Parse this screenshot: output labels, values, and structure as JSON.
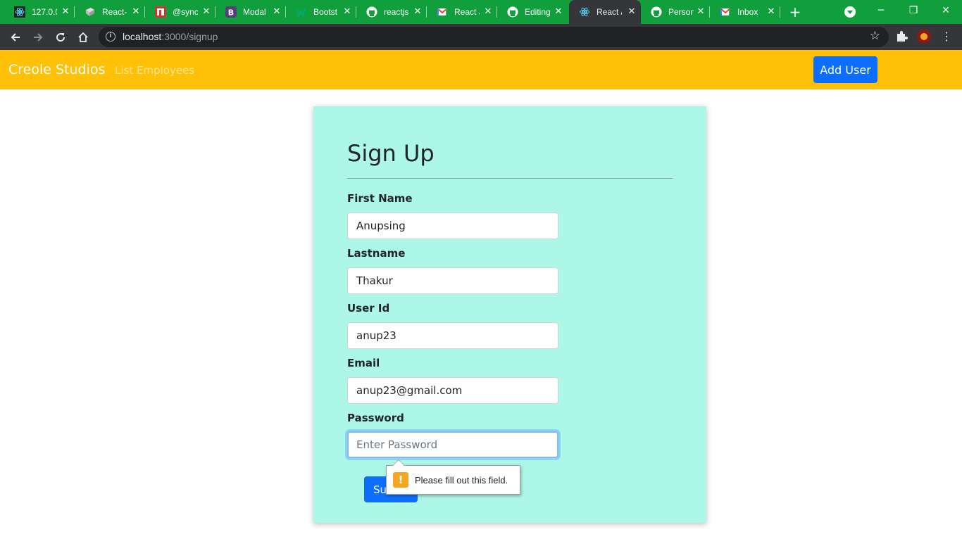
{
  "browser": {
    "tabs": [
      {
        "title": "127.0.0",
        "icon": "react-icon"
      },
      {
        "title": "React-",
        "icon": "gitbook-icon"
      },
      {
        "title": "@sync",
        "icon": "npm-icon"
      },
      {
        "title": "Modal",
        "icon": "bootstrap-icon"
      },
      {
        "title": "Bootst",
        "icon": "w3-icon"
      },
      {
        "title": "reactjs",
        "icon": "github-icon"
      },
      {
        "title": "React J",
        "icon": "gmail-icon"
      },
      {
        "title": "Editing",
        "icon": "github-icon"
      },
      {
        "title": "React /",
        "icon": "react-icon"
      },
      {
        "title": "Person",
        "icon": "github-icon"
      },
      {
        "title": "Inbox",
        "icon": "gmail-icon"
      }
    ],
    "active_tab_index": 8,
    "url_host": "localhost",
    "url_path": ":3000/signup"
  },
  "navbar": {
    "brand": "Creole Studios",
    "link": "List Employees",
    "add_user": "Add User",
    "bg_color": "#ffc107",
    "button_color": "#0d6efd"
  },
  "form": {
    "title": "Sign Up",
    "card_color": "#adf7e9",
    "fields": [
      {
        "label": "First Name",
        "value": "Anupsing",
        "placeholder": ""
      },
      {
        "label": "Lastname",
        "value": "Thakur",
        "placeholder": ""
      },
      {
        "label": "User Id",
        "value": "anup23",
        "placeholder": ""
      },
      {
        "label": "Email",
        "value": "anup23@gmail.com",
        "placeholder": ""
      },
      {
        "label": "Password",
        "value": "",
        "placeholder": "Enter Password"
      }
    ],
    "submit": "Submit",
    "validation_message": "Please fill out this field."
  }
}
